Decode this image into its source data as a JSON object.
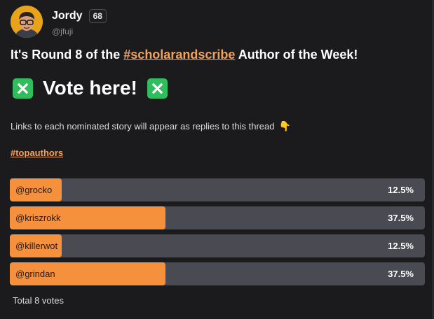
{
  "post": {
    "author": {
      "name": "Jordy",
      "level": "68",
      "handle": "@jfuji"
    },
    "headline_prefix": "It's Round 8 of the ",
    "headline_link": "#scholarandscribe",
    "headline_suffix": " Author of the Week!",
    "vote_text": "Vote here!",
    "body": "Links to each nominated story will appear as replies to this thread",
    "hashtag": "#topauthors"
  },
  "poll": {
    "options": [
      {
        "label": "@grocko",
        "percent_text": "12.5%",
        "fraction": 0.125
      },
      {
        "label": "@kriszrokk",
        "percent_text": "37.5%",
        "fraction": 0.375
      },
      {
        "label": "@killerwot",
        "percent_text": "12.5%",
        "fraction": 0.125
      },
      {
        "label": "@grindan",
        "percent_text": "37.5%",
        "fraction": 0.375
      }
    ],
    "total": "Total 8 votes"
  },
  "icons": {
    "vote_emoji": "cross-mark-button-icon",
    "pointing_emoji": "backhand-index-pointing-down-icon"
  },
  "colors": {
    "accent": "#f5913d",
    "link": "#f2a25a",
    "emoji_green": "#2fbd5e"
  }
}
